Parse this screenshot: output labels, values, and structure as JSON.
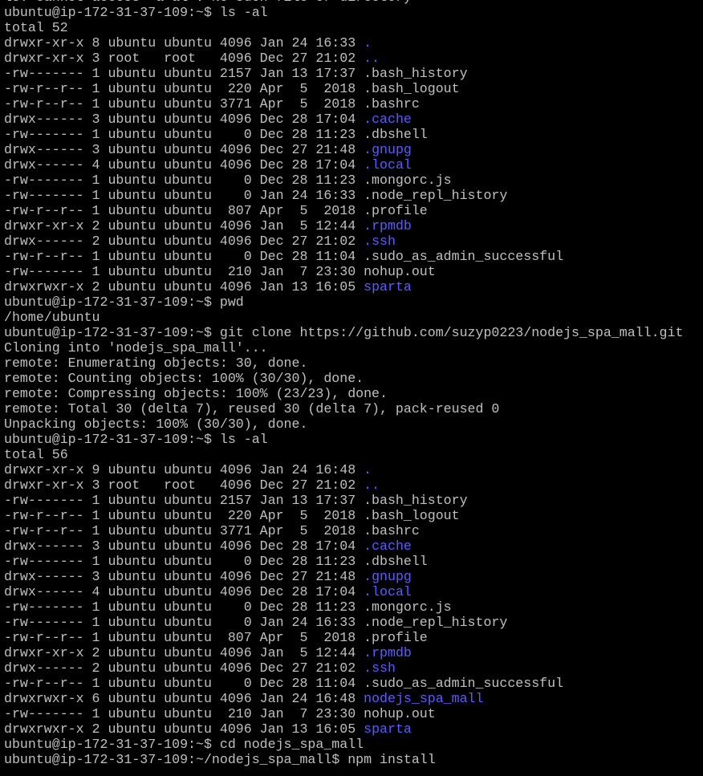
{
  "colors": {
    "background": "#000000",
    "foreground": "#c0c0c0",
    "directory": "#5c5cff"
  },
  "lines": [
    {
      "segs": [
        {
          "t": "ls: cannot access 'a-al': No such file or directory",
          "c": "text"
        }
      ]
    },
    {
      "segs": [
        {
          "t": "ubuntu@ip-172-31-37-109:~$ ls -al",
          "c": "text"
        }
      ]
    },
    {
      "segs": [
        {
          "t": "total 52",
          "c": "text"
        }
      ]
    },
    {
      "segs": [
        {
          "t": "drwxr-xr-x 8 ubuntu ubuntu 4096 Jan 24 16:33 ",
          "c": "text"
        },
        {
          "t": ".",
          "c": "dir"
        }
      ]
    },
    {
      "segs": [
        {
          "t": "drwxr-xr-x 3 root   root   4096 Dec 27 21:02 ",
          "c": "text"
        },
        {
          "t": "..",
          "c": "dir"
        }
      ]
    },
    {
      "segs": [
        {
          "t": "-rw------- 1 ubuntu ubuntu 2157 Jan 13 17:37 .bash_history",
          "c": "text"
        }
      ]
    },
    {
      "segs": [
        {
          "t": "-rw-r--r-- 1 ubuntu ubuntu  220 Apr  5  2018 .bash_logout",
          "c": "text"
        }
      ]
    },
    {
      "segs": [
        {
          "t": "-rw-r--r-- 1 ubuntu ubuntu 3771 Apr  5  2018 .bashrc",
          "c": "text"
        }
      ]
    },
    {
      "segs": [
        {
          "t": "drwx------ 3 ubuntu ubuntu 4096 Dec 28 17:04 ",
          "c": "text"
        },
        {
          "t": ".cache",
          "c": "dir"
        }
      ]
    },
    {
      "segs": [
        {
          "t": "-rw------- 1 ubuntu ubuntu    0 Dec 28 11:23 .dbshell",
          "c": "text"
        }
      ]
    },
    {
      "segs": [
        {
          "t": "drwx------ 3 ubuntu ubuntu 4096 Dec 27 21:48 ",
          "c": "text"
        },
        {
          "t": ".gnupg",
          "c": "dir"
        }
      ]
    },
    {
      "segs": [
        {
          "t": "drwx------ 4 ubuntu ubuntu 4096 Dec 28 17:04 ",
          "c": "text"
        },
        {
          "t": ".local",
          "c": "dir"
        }
      ]
    },
    {
      "segs": [
        {
          "t": "-rw------- 1 ubuntu ubuntu    0 Dec 28 11:23 .mongorc.js",
          "c": "text"
        }
      ]
    },
    {
      "segs": [
        {
          "t": "-rw------- 1 ubuntu ubuntu    0 Jan 24 16:33 .node_repl_history",
          "c": "text"
        }
      ]
    },
    {
      "segs": [
        {
          "t": "-rw-r--r-- 1 ubuntu ubuntu  807 Apr  5  2018 .profile",
          "c": "text"
        }
      ]
    },
    {
      "segs": [
        {
          "t": "drwxr-xr-x 2 ubuntu ubuntu 4096 Jan  5 12:44 ",
          "c": "text"
        },
        {
          "t": ".rpmdb",
          "c": "dir"
        }
      ]
    },
    {
      "segs": [
        {
          "t": "drwx------ 2 ubuntu ubuntu 4096 Dec 27 21:02 ",
          "c": "text"
        },
        {
          "t": ".ssh",
          "c": "dir"
        }
      ]
    },
    {
      "segs": [
        {
          "t": "-rw-r--r-- 1 ubuntu ubuntu    0 Dec 28 11:04 .sudo_as_admin_successful",
          "c": "text"
        }
      ]
    },
    {
      "segs": [
        {
          "t": "-rw------- 1 ubuntu ubuntu  210 Jan  7 23:30 nohup.out",
          "c": "text"
        }
      ]
    },
    {
      "segs": [
        {
          "t": "drwxrwxr-x 2 ubuntu ubuntu 4096 Jan 13 16:05 ",
          "c": "text"
        },
        {
          "t": "sparta",
          "c": "dir"
        }
      ]
    },
    {
      "segs": [
        {
          "t": "ubuntu@ip-172-31-37-109:~$ pwd",
          "c": "text"
        }
      ]
    },
    {
      "segs": [
        {
          "t": "/home/ubuntu",
          "c": "text"
        }
      ]
    },
    {
      "segs": [
        {
          "t": "ubuntu@ip-172-31-37-109:~$ git clone https://github.com/suzyp0223/nodejs_spa_mall.git",
          "c": "text"
        }
      ]
    },
    {
      "segs": [
        {
          "t": "Cloning into 'nodejs_spa_mall'...",
          "c": "text"
        }
      ]
    },
    {
      "segs": [
        {
          "t": "remote: Enumerating objects: 30, done.",
          "c": "text"
        }
      ]
    },
    {
      "segs": [
        {
          "t": "remote: Counting objects: 100% (30/30), done.",
          "c": "text"
        }
      ]
    },
    {
      "segs": [
        {
          "t": "remote: Compressing objects: 100% (23/23), done.",
          "c": "text"
        }
      ]
    },
    {
      "segs": [
        {
          "t": "remote: Total 30 (delta 7), reused 30 (delta 7), pack-reused 0",
          "c": "text"
        }
      ]
    },
    {
      "segs": [
        {
          "t": "Unpacking objects: 100% (30/30), done.",
          "c": "text"
        }
      ]
    },
    {
      "segs": [
        {
          "t": "ubuntu@ip-172-31-37-109:~$ ls -al",
          "c": "text"
        }
      ]
    },
    {
      "segs": [
        {
          "t": "total 56",
          "c": "text"
        }
      ]
    },
    {
      "segs": [
        {
          "t": "drwxr-xr-x 9 ubuntu ubuntu 4096 Jan 24 16:48 ",
          "c": "text"
        },
        {
          "t": ".",
          "c": "dir"
        }
      ]
    },
    {
      "segs": [
        {
          "t": "drwxr-xr-x 3 root   root   4096 Dec 27 21:02 ",
          "c": "text"
        },
        {
          "t": "..",
          "c": "dir"
        }
      ]
    },
    {
      "segs": [
        {
          "t": "-rw------- 1 ubuntu ubuntu 2157 Jan 13 17:37 .bash_history",
          "c": "text"
        }
      ]
    },
    {
      "segs": [
        {
          "t": "-rw-r--r-- 1 ubuntu ubuntu  220 Apr  5  2018 .bash_logout",
          "c": "text"
        }
      ]
    },
    {
      "segs": [
        {
          "t": "-rw-r--r-- 1 ubuntu ubuntu 3771 Apr  5  2018 .bashrc",
          "c": "text"
        }
      ]
    },
    {
      "segs": [
        {
          "t": "drwx------ 3 ubuntu ubuntu 4096 Dec 28 17:04 ",
          "c": "text"
        },
        {
          "t": ".cache",
          "c": "dir"
        }
      ]
    },
    {
      "segs": [
        {
          "t": "-rw------- 1 ubuntu ubuntu    0 Dec 28 11:23 .dbshell",
          "c": "text"
        }
      ]
    },
    {
      "segs": [
        {
          "t": "drwx------ 3 ubuntu ubuntu 4096 Dec 27 21:48 ",
          "c": "text"
        },
        {
          "t": ".gnupg",
          "c": "dir"
        }
      ]
    },
    {
      "segs": [
        {
          "t": "drwx------ 4 ubuntu ubuntu 4096 Dec 28 17:04 ",
          "c": "text"
        },
        {
          "t": ".local",
          "c": "dir"
        }
      ]
    },
    {
      "segs": [
        {
          "t": "-rw------- 1 ubuntu ubuntu    0 Dec 28 11:23 .mongorc.js",
          "c": "text"
        }
      ]
    },
    {
      "segs": [
        {
          "t": "-rw------- 1 ubuntu ubuntu    0 Jan 24 16:33 .node_repl_history",
          "c": "text"
        }
      ]
    },
    {
      "segs": [
        {
          "t": "-rw-r--r-- 1 ubuntu ubuntu  807 Apr  5  2018 .profile",
          "c": "text"
        }
      ]
    },
    {
      "segs": [
        {
          "t": "drwxr-xr-x 2 ubuntu ubuntu 4096 Jan  5 12:44 ",
          "c": "text"
        },
        {
          "t": ".rpmdb",
          "c": "dir"
        }
      ]
    },
    {
      "segs": [
        {
          "t": "drwx------ 2 ubuntu ubuntu 4096 Dec 27 21:02 ",
          "c": "text"
        },
        {
          "t": ".ssh",
          "c": "dir"
        }
      ]
    },
    {
      "segs": [
        {
          "t": "-rw-r--r-- 1 ubuntu ubuntu    0 Dec 28 11:04 .sudo_as_admin_successful",
          "c": "text"
        }
      ]
    },
    {
      "segs": [
        {
          "t": "drwxrwxr-x 6 ubuntu ubuntu 4096 Jan 24 16:48 ",
          "c": "text"
        },
        {
          "t": "nodejs_spa_mall",
          "c": "dir"
        }
      ]
    },
    {
      "segs": [
        {
          "t": "-rw------- 1 ubuntu ubuntu  210 Jan  7 23:30 nohup.out",
          "c": "text"
        }
      ]
    },
    {
      "segs": [
        {
          "t": "drwxrwxr-x 2 ubuntu ubuntu 4096 Jan 13 16:05 ",
          "c": "text"
        },
        {
          "t": "sparta",
          "c": "dir"
        }
      ]
    },
    {
      "segs": [
        {
          "t": "ubuntu@ip-172-31-37-109:~$ cd nodejs_spa_mall",
          "c": "text"
        }
      ]
    },
    {
      "segs": [
        {
          "t": "ubuntu@ip-172-31-37-109:~/nodejs_spa_mall$ npm install",
          "c": "text"
        }
      ]
    }
  ]
}
